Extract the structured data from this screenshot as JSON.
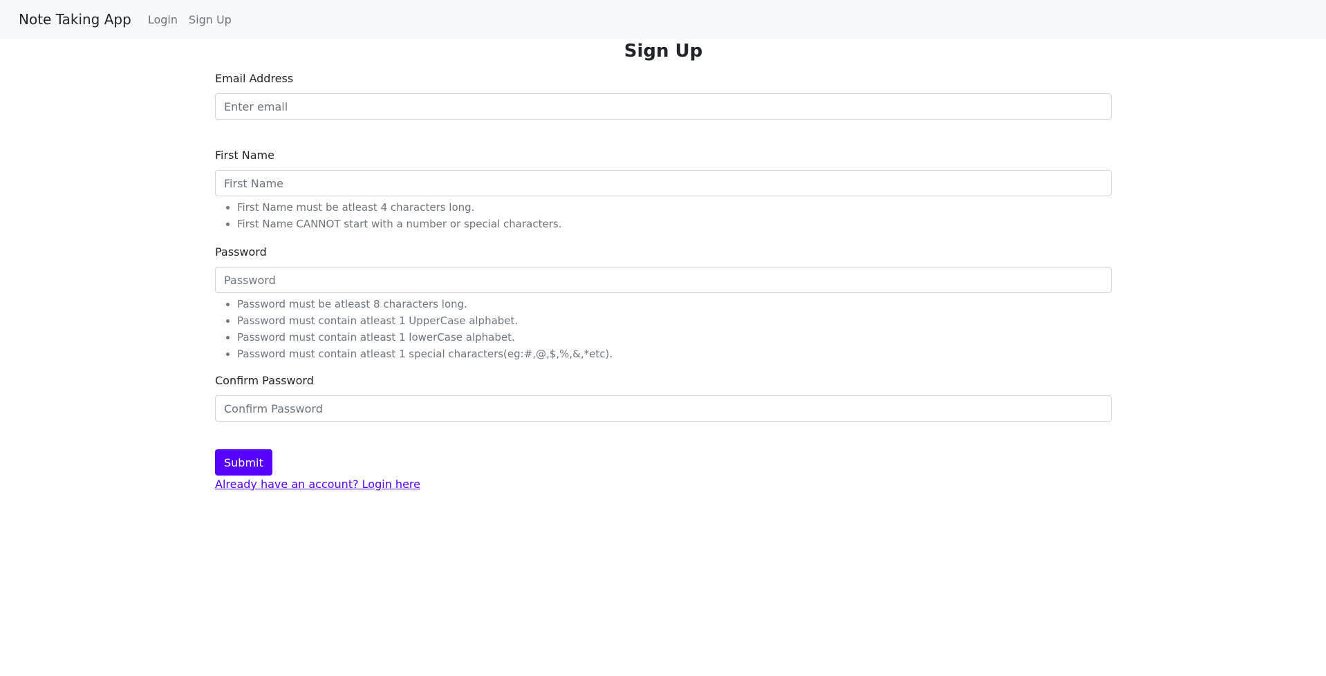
{
  "navbar": {
    "brand": "Note Taking App",
    "links": [
      {
        "label": "Login"
      },
      {
        "label": "Sign Up"
      }
    ]
  },
  "page": {
    "title": "Sign Up"
  },
  "form": {
    "email": {
      "label": "Email Address",
      "value": "",
      "placeholder": "Enter email"
    },
    "first_name": {
      "label": "First Name",
      "value": "",
      "placeholder": "First Name",
      "hints": [
        "First Name must be atleast 4 characters long.",
        "First Name CANNOT start with a number or special characters."
      ]
    },
    "password": {
      "label": "Password",
      "value": "",
      "placeholder": "Password",
      "hints": [
        "Password must be atleast 8 characters long.",
        "Password must contain atleast 1 UpperCase alphabet.",
        "Password must contain atleast 1 lowerCase alphabet.",
        "Password must contain atleast 1 special characters(eg:#,@,$,%,&,*etc)."
      ]
    },
    "confirm_password": {
      "label": "Confirm Password",
      "value": "",
      "placeholder": "Confirm Password"
    },
    "submit_label": "Submit",
    "login_link": "Already have an account? Login here"
  },
  "colors": {
    "primary": "#5600ff",
    "navbar_bg": "#f8f9fa",
    "muted_text": "#6c757d",
    "input_border": "#ced4da"
  }
}
